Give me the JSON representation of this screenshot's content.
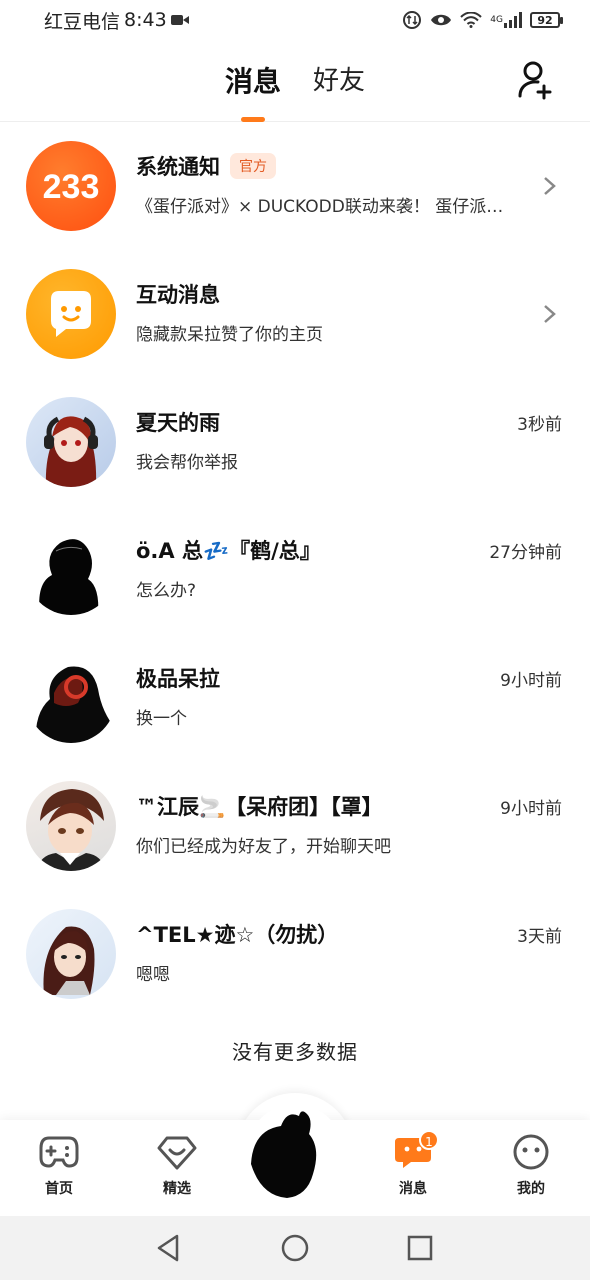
{
  "status_bar": {
    "carrier": "红豆电信",
    "time": "8:43",
    "battery": "92",
    "network": "4G"
  },
  "header": {
    "tabs": [
      {
        "label": "消息",
        "active": true
      },
      {
        "label": "好友",
        "active": false
      }
    ],
    "accent_color": "#ff7a1a"
  },
  "messages": [
    {
      "name": "系统通知",
      "badge": "官方",
      "preview": "《蛋仔派对》× DUCKODD联动来袭！ 蛋仔派对…",
      "time": "",
      "avatar": "233-logo",
      "has_chevron": true
    },
    {
      "name": "互动消息",
      "badge": "",
      "preview": "隐藏款呆拉赞了你的主页",
      "time": "",
      "avatar": "chat-bubble-icon",
      "has_chevron": true
    },
    {
      "name": "夏天的雨",
      "badge": "",
      "preview": "我会帮你举报",
      "time": "3秒前",
      "avatar": "user-avatar",
      "has_chevron": false
    },
    {
      "name": "ö.A 总💤『鹤/总』",
      "badge": "",
      "preview": "怎么办?",
      "time": "27分钟前",
      "avatar": "user-avatar",
      "has_chevron": false
    },
    {
      "name": "极品呆拉",
      "badge": "",
      "preview": "换一个",
      "time": "9小时前",
      "avatar": "user-avatar",
      "has_chevron": false
    },
    {
      "name": "™江辰🚬【呆府团】【罩】",
      "badge": "",
      "preview": "你们已经成为好友了，开始聊天吧",
      "time": "9小时前",
      "avatar": "user-avatar",
      "has_chevron": false
    },
    {
      "name": "^TEL★迹☆（勿扰）",
      "badge": "",
      "preview": "嗯嗯",
      "time": "3天前",
      "avatar": "user-avatar",
      "has_chevron": false
    }
  ],
  "footer_text": "没有更多数据",
  "bottom_nav": {
    "items": [
      {
        "label": "首页",
        "icon": "gamepad-icon"
      },
      {
        "label": "精选",
        "icon": "heart-gem-icon"
      },
      {
        "label": "消息",
        "icon": "message-icon",
        "badge": "1"
      },
      {
        "label": "我的",
        "icon": "face-icon"
      }
    ]
  }
}
